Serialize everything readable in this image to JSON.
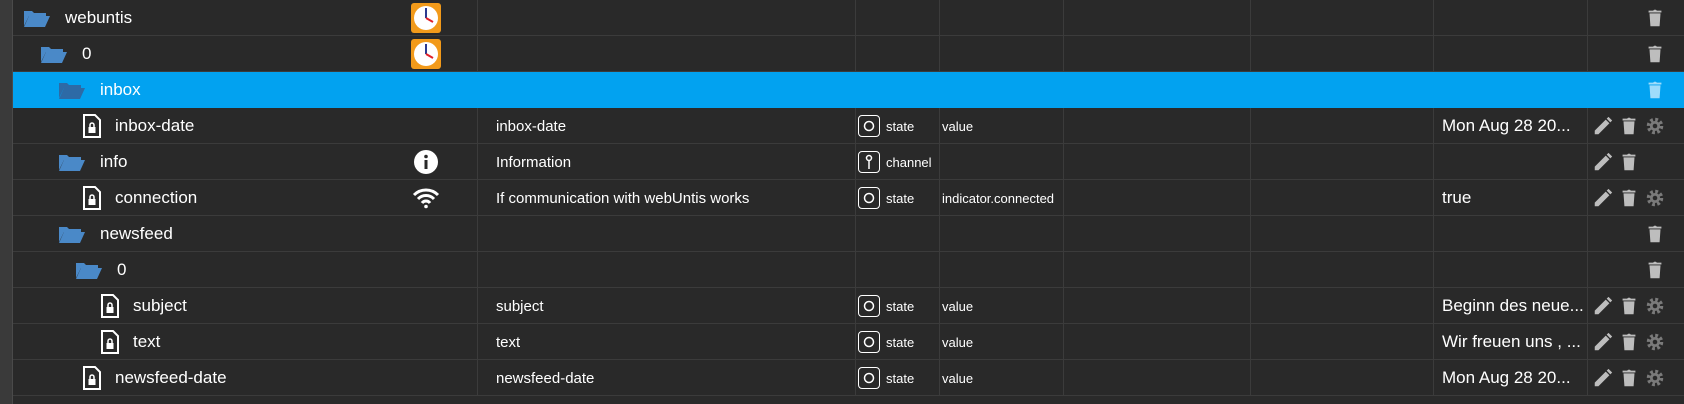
{
  "colors": {
    "selected_row": "#02a2f0",
    "folder": "#4a89c8",
    "icon_gray": "#bdbdbd",
    "gear_gray": "#7a7a7a"
  },
  "rows": [
    {
      "name": "webuntis",
      "label": "",
      "type": "",
      "role": "",
      "value": ""
    },
    {
      "name": "0",
      "label": "",
      "type": "",
      "role": "",
      "value": ""
    },
    {
      "name": "inbox",
      "label": "",
      "type": "",
      "role": "",
      "value": ""
    },
    {
      "name": "inbox-date",
      "label": "inbox-date",
      "type": "state",
      "role": "value",
      "value": "Mon Aug 28 20..."
    },
    {
      "name": "info",
      "label": "Information",
      "type": "channel",
      "role": "",
      "value": ""
    },
    {
      "name": "connection",
      "label": "If communication with webUntis works",
      "type": "state",
      "role": "indicator.connected",
      "value": "true"
    },
    {
      "name": "newsfeed",
      "label": "",
      "type": "",
      "role": "",
      "value": ""
    },
    {
      "name": "0",
      "label": "",
      "type": "",
      "role": "",
      "value": ""
    },
    {
      "name": "subject",
      "label": "subject",
      "type": "state",
      "role": "value",
      "value": "Beginn des neue..."
    },
    {
      "name": "text",
      "label": "text",
      "type": "state",
      "role": "value",
      "value": "Wir freuen uns , ..."
    },
    {
      "name": "newsfeed-date",
      "label": "newsfeed-date",
      "type": "state",
      "role": "value",
      "value": "Mon Aug 28 20..."
    }
  ]
}
